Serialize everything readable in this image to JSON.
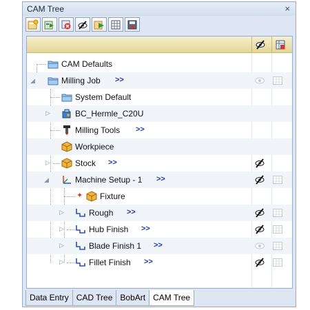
{
  "window": {
    "title": "CAM Tree",
    "close_glyph": "×"
  },
  "toolbar": {
    "buttons": [
      {
        "name": "new-job-icon"
      },
      {
        "name": "import-icon"
      },
      {
        "name": "delete-icon"
      },
      {
        "name": "hide-icon"
      },
      {
        "name": "generate-icon"
      },
      {
        "name": "grid-icon"
      },
      {
        "name": "save-icon"
      }
    ]
  },
  "header": {
    "col1_icon": "visibility-pen-icon",
    "col2_icon": "calculator-icon"
  },
  "tree": {
    "rows": [
      {
        "label": "CAM Defaults",
        "more": "",
        "vis": "",
        "calc": ""
      },
      {
        "label": "Milling Job",
        "more": ">>",
        "vis": "eye-icon",
        "calc": "grid-icon"
      },
      {
        "label": "System Default",
        "more": "",
        "vis": "",
        "calc": ""
      },
      {
        "label": "BC_Hermle_C20U",
        "more": "",
        "vis": "",
        "calc": ""
      },
      {
        "label": "Milling Tools",
        "more": ">>",
        "vis": "",
        "calc": ""
      },
      {
        "label": "Workpiece",
        "more": "",
        "vis": "",
        "calc": ""
      },
      {
        "label": "Stock",
        "more": ">>",
        "vis": "pen-icon",
        "calc": ""
      },
      {
        "label": "Machine Setup - 1",
        "more": ">>",
        "vis": "pen-icon",
        "calc": "grid-icon"
      },
      {
        "label": "Fixture",
        "more": "",
        "vis": "",
        "calc": ""
      },
      {
        "label": "Rough",
        "more": ">>",
        "vis": "pen-icon",
        "calc": "grid-icon"
      },
      {
        "label": "Hub Finish",
        "more": ">>",
        "vis": "pen-icon",
        "calc": "grid-icon"
      },
      {
        "label": "Blade Finish 1",
        "more": ">>",
        "vis": "eye-icon",
        "calc": "grid-icon"
      },
      {
        "label": "Fillet Finish",
        "more": ">>",
        "vis": "pen-icon",
        "calc": "grid-icon"
      }
    ]
  },
  "tabs": [
    {
      "label": "Data Entry"
    },
    {
      "label": "CAD Tree"
    },
    {
      "label": "BobArt"
    },
    {
      "label": "CAM Tree"
    }
  ],
  "colors": {
    "accent_more": "#1a3aa8",
    "panel_bg": "#dde6f2",
    "header_gold": "#e4d698"
  }
}
